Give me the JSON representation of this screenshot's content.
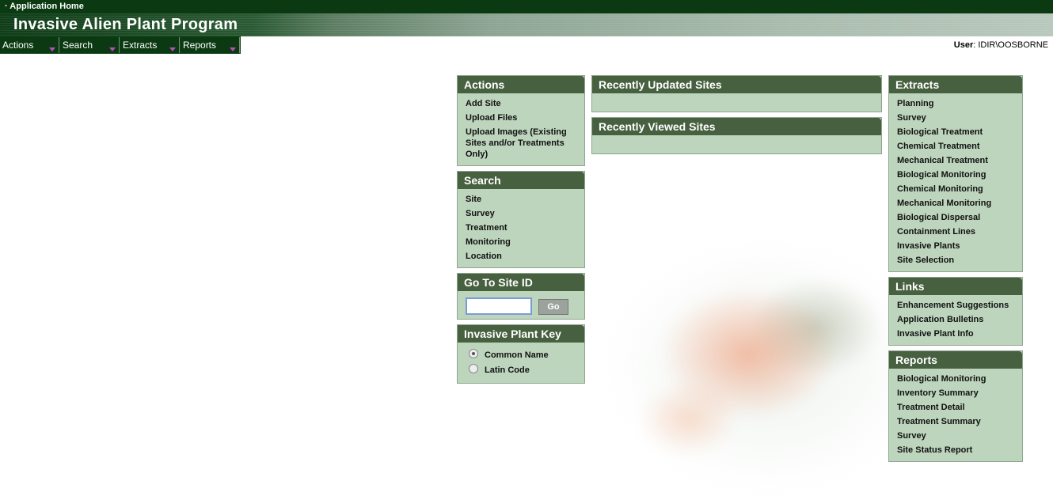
{
  "topbar": {
    "home_link": "· Application Home"
  },
  "app_title": "Invasive Alien Plant Program",
  "menu": [
    {
      "label": "Actions"
    },
    {
      "label": "Search"
    },
    {
      "label": "Extracts"
    },
    {
      "label": "Reports"
    }
  ],
  "user": {
    "label": "User",
    "value": ": IDIR\\OOSBORNE"
  },
  "actions_panel": {
    "title": "Actions",
    "items": [
      "Add Site",
      "Upload Files",
      "Upload Images (Existing Sites and/or Treatments Only)"
    ]
  },
  "search_panel": {
    "title": "Search",
    "items": [
      "Site",
      "Survey",
      "Treatment",
      "Monitoring",
      "Location"
    ]
  },
  "goto_panel": {
    "title": "Go To Site ID",
    "input_value": "",
    "button": "Go"
  },
  "plant_key_panel": {
    "title": "Invasive Plant Key",
    "options": [
      "Common Name",
      "Latin Code"
    ],
    "selected": "Common Name"
  },
  "recent_updated": {
    "title": "Recently Updated Sites"
  },
  "recent_viewed": {
    "title": "Recently Viewed Sites"
  },
  "extracts_panel": {
    "title": "Extracts",
    "items": [
      "Planning",
      "Survey",
      "Biological Treatment",
      "Chemical Treatment",
      "Mechanical Treatment",
      "Biological Monitoring",
      "Chemical Monitoring",
      "Mechanical Monitoring",
      "Biological Dispersal",
      "Containment Lines",
      "Invasive Plants",
      "Site Selection"
    ]
  },
  "links_panel": {
    "title": "Links",
    "items": [
      "Enhancement Suggestions",
      "Application Bulletins",
      "Invasive Plant Info"
    ]
  },
  "reports_panel": {
    "title": "Reports",
    "items": [
      "Biological Monitoring",
      "Inventory Summary",
      "Treatment Detail",
      "Treatment Summary",
      "Survey",
      "Site Status Report"
    ]
  },
  "colors": {
    "header_dark": "#0b3a12",
    "panel_head": "#47603f",
    "panel_body": "#bdd5bd",
    "menu_arrow": "#b84cc0"
  }
}
